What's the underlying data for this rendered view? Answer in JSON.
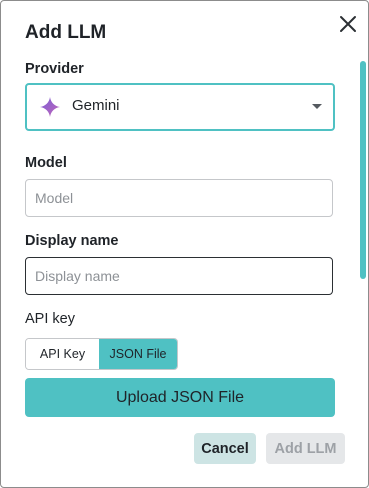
{
  "dialog": {
    "title": "Add LLM",
    "close_icon": "close-icon"
  },
  "provider": {
    "label": "Provider",
    "value": "Gemini",
    "icon": "gemini-icon"
  },
  "model": {
    "label": "Model",
    "placeholder": "Model",
    "value": ""
  },
  "display_name": {
    "label": "Display name",
    "placeholder": "Display name",
    "value": ""
  },
  "api_key": {
    "label": "API key",
    "options": [
      "API Key",
      "JSON File"
    ],
    "selected": "JSON File"
  },
  "upload": {
    "label": "Upload JSON File"
  },
  "footer": {
    "cancel_label": "Cancel",
    "add_label": "Add LLM"
  },
  "colors": {
    "accent": "#4fc1c3",
    "cancel_bg": "#cde4e4",
    "disabled_bg": "#e5e7e9"
  }
}
